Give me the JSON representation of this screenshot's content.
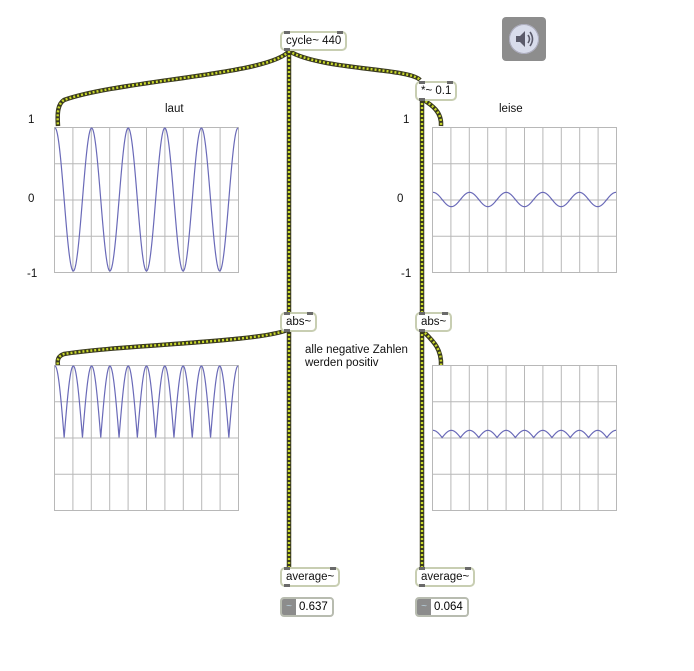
{
  "objects": {
    "cycle": "cycle~ 440",
    "mult": "*~ 0.1",
    "abs_left": "abs~",
    "abs_right": "abs~",
    "average_left": "average~",
    "average_right": "average~"
  },
  "labels": {
    "laut": "laut",
    "leise": "leise",
    "axis_top_left": "1",
    "axis_mid_left": "0",
    "axis_bottom_left": "-1",
    "axis_top_right": "1",
    "axis_mid_right": "0",
    "axis_bottom_right": "-1"
  },
  "comment": "alle negative Zahlen\nwerden positiv",
  "number_boxes": {
    "left_value": "0.637",
    "right_value": "0.064",
    "arrow_glyph": "~"
  },
  "scopes": {
    "top_left": {
      "wave": "sine",
      "amplitude": 1.0,
      "cycles": 5
    },
    "top_right": {
      "wave": "sine",
      "amplitude": 0.1,
      "cycles": 5
    },
    "bottom_left": {
      "wave": "abs",
      "amplitude": 1.0,
      "cycles": 5
    },
    "bottom_right": {
      "wave": "abs",
      "amplitude": 0.1,
      "cycles": 5
    }
  },
  "colors": {
    "trace": "#6a6ab8",
    "grid": "#b8b8b8",
    "patch_cord_stripe": "#c8d82a",
    "patch_cord_base": "#3a3a1e",
    "object_border": "#c8ceb2"
  },
  "icons": {
    "dac": "speaker-icon"
  }
}
